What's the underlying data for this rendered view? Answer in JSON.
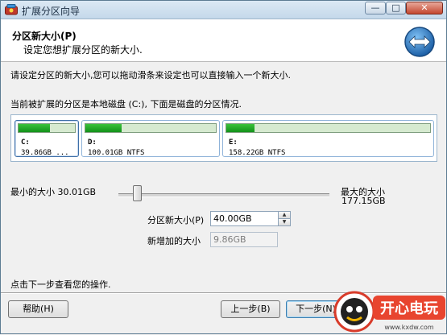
{
  "window": {
    "title": "扩展分区向导",
    "controls": {
      "minimize": "—",
      "maximize": "□",
      "close": "✕"
    }
  },
  "header": {
    "title": "分区新大小(P)",
    "subtitle": "设定您想扩展分区的新大小.",
    "icon": "resize-arrows-icon"
  },
  "instructions": "请设定分区的新大小,您可以拖动滑条来设定也可以直接输入一个新大小.",
  "partitions_caption": "当前被扩展的分区是本地磁盘 (C:), 下面是磁盘的分区情况.",
  "partitions": [
    {
      "drive": "C:",
      "info": "39.86GB ...",
      "used_fraction": 0.55,
      "selected": true
    },
    {
      "drive": "D:",
      "info": "100.01GB NTFS",
      "used_fraction": 0.28,
      "selected": false
    },
    {
      "drive": "E:",
      "info": "158.22GB NTFS",
      "used_fraction": 0.14,
      "selected": false
    }
  ],
  "slider": {
    "min_label": "最小的大小 30.01GB",
    "max_label": "最大的大小",
    "max_value": "177.15GB",
    "position_fraction": 0.07
  },
  "new_size": {
    "label": "分区新大小(P)",
    "value": "40.00GB"
  },
  "increase": {
    "label": "新增加的大小",
    "value": "9.86GB"
  },
  "footer_hint": "点击下一步查看您的操作.",
  "buttons": {
    "help": "帮助(H)",
    "back": "上一步(B)",
    "next": "下一步(N)"
  },
  "watermark": {
    "brand": "开心电玩",
    "url": "www.kxdw.com"
  },
  "colors": {
    "accent": "#3c7fb1",
    "used_bar": "#1fa526",
    "title_bg": "#c4d8ea"
  }
}
